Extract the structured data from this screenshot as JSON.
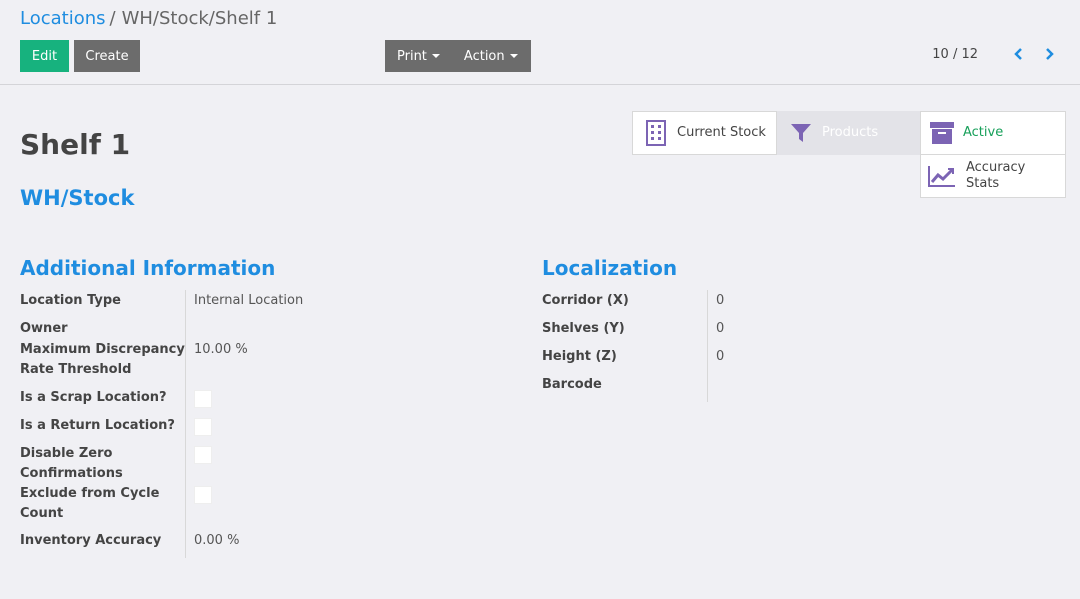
{
  "breadcrumb": {
    "parent": "Locations",
    "separator": "/",
    "current": "WH/Stock/Shelf 1"
  },
  "toolbar": {
    "edit_label": "Edit",
    "create_label": "Create",
    "print_label": "Print",
    "action_label": "Action"
  },
  "pager": {
    "value": "10 / 12"
  },
  "record": {
    "name": "Shelf 1",
    "parent_location": "WH/Stock"
  },
  "smart_buttons": {
    "current_stock": "Current Stock",
    "products": "Products",
    "active": "Active",
    "accuracy_line1": "Accuracy",
    "accuracy_line2": "Stats"
  },
  "additional_info": {
    "title": "Additional Information",
    "location_type_label": "Location Type",
    "location_type_value": "Internal Location",
    "owner_label": "Owner",
    "owner_value": "",
    "max_discrepancy_label": "Maximum Discrepancy Rate Threshold",
    "max_discrepancy_value": "10.00 %",
    "scrap_label": "Is a Scrap Location?",
    "return_label": "Is a Return Location?",
    "disable_zero_label": "Disable Zero Confirmations",
    "exclude_cycle_label": "Exclude from Cycle Count",
    "inventory_accuracy_label": "Inventory Accuracy",
    "inventory_accuracy_value": "0.00 %"
  },
  "localization": {
    "title": "Localization",
    "corridor_label": "Corridor (X)",
    "corridor_value": "0",
    "shelves_label": "Shelves (Y)",
    "shelves_value": "0",
    "height_label": "Height (Z)",
    "height_value": "0",
    "barcode_label": "Barcode",
    "barcode_value": ""
  },
  "colors": {
    "link": "#1f8de0",
    "primary": "#17b27e",
    "secondary": "#6c6c6c",
    "active_green": "#17a05a",
    "icon_purple": "#7c64b4"
  }
}
